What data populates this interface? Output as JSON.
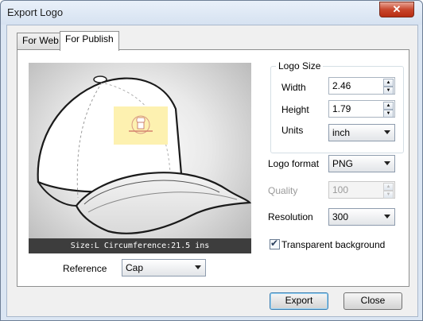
{
  "window": {
    "title": "Export Logo",
    "close_symbol": "✕"
  },
  "tabs": [
    {
      "label": "For Web"
    },
    {
      "label": "For Publish"
    }
  ],
  "preview": {
    "status": "Size:L  Circumference:21.5 ins"
  },
  "reference": {
    "label": "Reference",
    "value": "Cap"
  },
  "logo_size": {
    "title": "Logo Size",
    "width": {
      "label": "Width",
      "value": "2.46"
    },
    "height": {
      "label": "Height",
      "value": "1.79"
    },
    "units": {
      "label": "Units",
      "value": "inch"
    }
  },
  "format": {
    "label": "Logo format",
    "value": "PNG"
  },
  "quality": {
    "label": "Quality",
    "value": "100"
  },
  "resolution": {
    "label": "Resolution",
    "value": "300"
  },
  "transparent": {
    "label": "Transparent background",
    "checked": true,
    "check_symbol": "✔"
  },
  "buttons": {
    "export": "Export",
    "close": "Close"
  },
  "spin_arrows": {
    "up": "▲",
    "down": "▼"
  },
  "colors": {
    "close_red": "#c8472d",
    "title_bg": "#dbe6f3",
    "logo_bg": "#fdf1b0"
  }
}
